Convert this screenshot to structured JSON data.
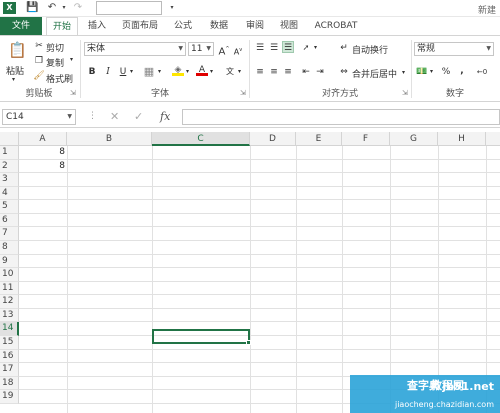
{
  "titlebar": {
    "right_text": "新建"
  },
  "tabs": [
    "文件",
    "开始",
    "插入",
    "页面布局",
    "公式",
    "数据",
    "审阅",
    "视图",
    "ACROBAT"
  ],
  "clipboard": {
    "paste": "粘贴",
    "cut": "剪切",
    "copy": "复制",
    "format_painter": "格式刷",
    "label": "剪贴板"
  },
  "font": {
    "name": "宋体",
    "size": "11",
    "bold": "B",
    "italic": "I",
    "underline": "U",
    "grow": "A",
    "shrink": "A",
    "label": "字体",
    "font_color": "A"
  },
  "alignment": {
    "wrap": "自动换行",
    "merge": "合并后居中",
    "label": "对齐方式"
  },
  "number": {
    "format": "常规",
    "percent": "%",
    "comma": ",",
    "label": "数字"
  },
  "formula_bar": {
    "name_box": "C14",
    "fx": "fx",
    "value": ""
  },
  "columns": [
    "A",
    "B",
    "C",
    "D",
    "E",
    "F",
    "G",
    "H"
  ],
  "rows": [
    "1",
    "2",
    "3",
    "4",
    "5",
    "6",
    "7",
    "8",
    "9",
    "10",
    "11",
    "12",
    "13",
    "14",
    "15",
    "16",
    "17",
    "18",
    "19"
  ],
  "cells": {
    "A1": "8",
    "A2": "8"
  },
  "selected": {
    "column": "C",
    "row": "14"
  },
  "watermark": {
    "brand": "jb51.net",
    "cn": "查字典",
    "cn2": "教程网",
    "url": "jiaocheng.chazidian.com"
  }
}
